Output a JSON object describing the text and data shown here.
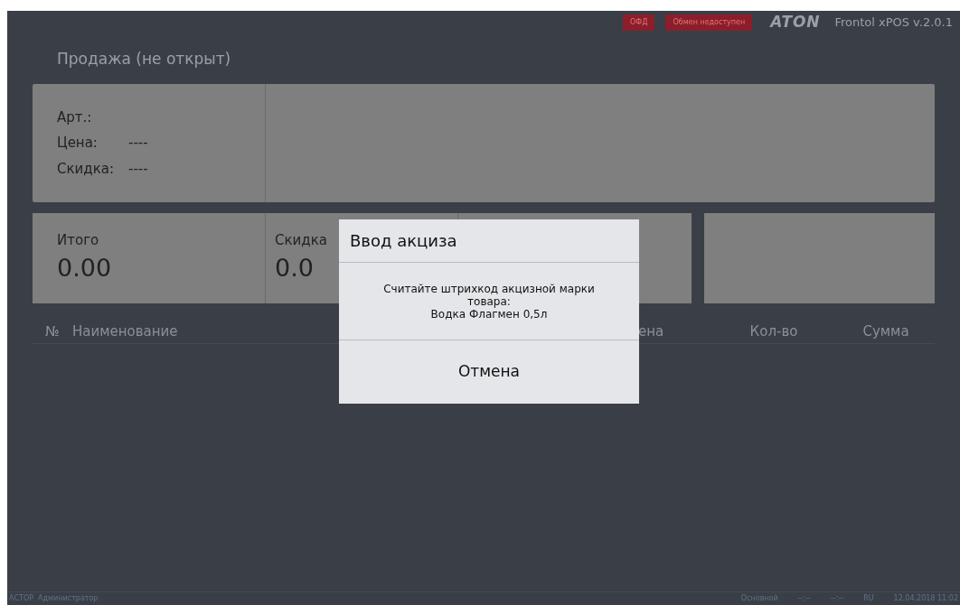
{
  "header": {
    "badges": [
      "ОФД",
      "Обмен недоступен"
    ],
    "logo": "ATON",
    "version": "Frontol xPOS v.2.0.1"
  },
  "title": "Продажа (не открыт)",
  "item_info": [
    {
      "label": "Арт.:"
    },
    {
      "label": "Цена:",
      "value": "----"
    },
    {
      "label": "Скидка:",
      "value": "----"
    }
  ],
  "totals": [
    {
      "label": "Итого",
      "value": "0.00"
    },
    {
      "label": "Скидка",
      "value": "0.0"
    }
  ],
  "table": {
    "columns": [
      "№",
      "Наименование",
      "ена",
      "Кол-во",
      "Сумма"
    ]
  },
  "dialog": {
    "title": "Ввод акциза",
    "message": "Считайте штрихкод акцизной марки товара:",
    "product": "Водка Флагмен 0,5л",
    "button": "Отмена"
  },
  "status_bar": {
    "left": [
      "АСТОР",
      "Администратор"
    ],
    "right": [
      "Основной",
      "--:--",
      "--:--",
      "RU",
      "12.04.2018 11:02"
    ]
  }
}
